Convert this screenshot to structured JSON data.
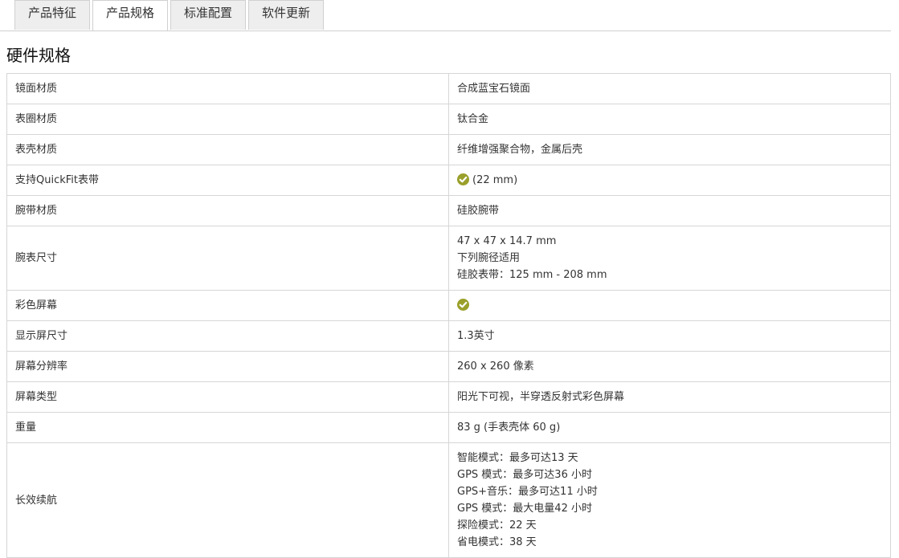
{
  "tabs": [
    {
      "label": "产品特征"
    },
    {
      "label": "产品规格"
    },
    {
      "label": "标准配置"
    },
    {
      "label": "软件更新"
    }
  ],
  "active_tab": "产品规格",
  "section": {
    "title": "硬件规格"
  },
  "specs": {
    "lens_material": {
      "label": "镜面材质",
      "value": "合成蓝宝石镜面"
    },
    "bezel_material": {
      "label": "表圈材质",
      "value": "钛合金"
    },
    "case_material": {
      "label": "表壳材质",
      "value": "纤维增强聚合物，金属后壳"
    },
    "quickfit": {
      "label": "支持QuickFit表带",
      "icon": "check-circle-icon",
      "value": "(22 mm)"
    },
    "strap_material": {
      "label": "腕带材质",
      "value": "硅胶腕带"
    },
    "size": {
      "label": "腕表尺寸",
      "lines": [
        "47 x 47 x 14.7 mm",
        "下列腕径适用",
        "硅胶表带：125 mm - 208 mm"
      ]
    },
    "color_display": {
      "label": "彩色屏幕",
      "icon": "check-circle-icon"
    },
    "display_size": {
      "label": "显示屏尺寸",
      "value": "1.3英寸"
    },
    "resolution": {
      "label": "屏幕分辨率",
      "value": "260 x 260 像素"
    },
    "display_type": {
      "label": "屏幕类型",
      "value": "阳光下可视，半穿透反射式彩色屏幕"
    },
    "weight": {
      "label": "重量",
      "value": "83 g (手表壳体 60 g)"
    },
    "battery": {
      "label": "长效续航",
      "lines": [
        "智能模式：最多可达13 天",
        "GPS 模式：最多可达36 小时",
        "GPS+音乐：最多可达11 小时",
        "GPS 模式：最大电量42 小时",
        "探险模式：22 天",
        "省电模式：38 天"
      ]
    }
  },
  "colors": {
    "accent_check": "#9aa02a",
    "border": "#d6d6d6"
  }
}
